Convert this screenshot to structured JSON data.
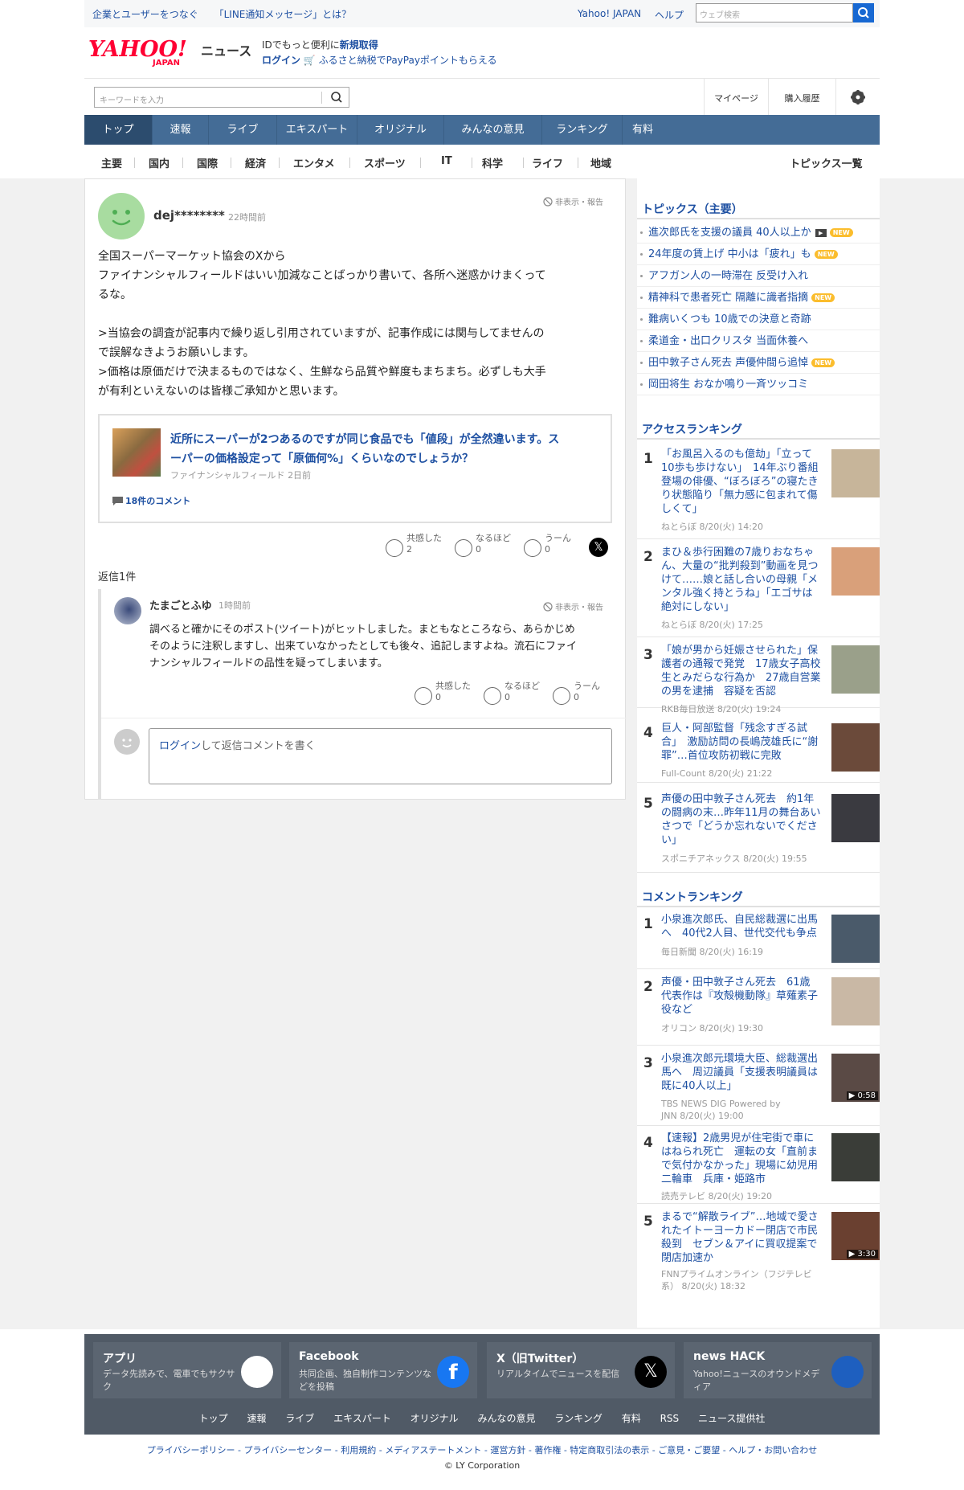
{
  "topbar": {
    "links": [
      "企業とユーザーをつなぐ",
      "「LINE通知メッセージ」とは？"
    ],
    "yahoo_japan": "Yahoo! JAPAN",
    "help": "ヘルプ",
    "search_placeholder": "ウェブ検索"
  },
  "header": {
    "logo_text": "YAHOO!",
    "logo_sub": "JAPAN",
    "news": "ニュース",
    "promo1_prefix": "IDでもっと便利に",
    "promo1_link": "新規取得",
    "promo2_login": "ログイン",
    "promo2_text": "ふるさと納税でPayPayポイントもらえる",
    "keyword_placeholder": "キーワードを入力",
    "mypage": "マイページ",
    "history": "購入履歴"
  },
  "nav": [
    "トップ",
    "速報",
    "ライブ",
    "エキスパート",
    "オリジナル",
    "みんなの意見",
    "ランキング",
    "有料"
  ],
  "subnav": [
    "主要",
    "国内",
    "国際",
    "経済",
    "エンタメ",
    "スポーツ",
    "IT",
    "科学",
    "ライフ",
    "地域"
  ],
  "subnav_topics": "トピックス一覧",
  "comment": {
    "user": "dej********",
    "time": "22時間前",
    "hide_report": "非表示・報告",
    "lines": [
      "全国スーパーマーケット協会のXから",
      "ファイナンシャルフィールドはいい加減なことばっかり書いて、各所へ迷惑かけまくって",
      "るな。",
      "",
      ">当協会の調査が記事内で繰り返し引用されていますが、記事作成には関与してませんの",
      "で誤解なきようお願いします。",
      ">価格は原価だけで決まるものではなく、生鮮なら品質や鮮度もまちまち。必ずしも大手",
      "が有利といえないのは皆様ご承知かと思います。"
    ],
    "article_title_1": "近所にスーパーが2つあるのですが同じ食品でも「値段」が全然違います。ス",
    "article_title_2": "ーパーの価格設定って「原価何%」くらいなのでしょうか？",
    "article_source": "ファイナンシャルフィールド",
    "article_time": "2日前",
    "article_comments": "18件のコメント",
    "reactions": [
      {
        "label": "共感した",
        "count": "2"
      },
      {
        "label": "なるほど",
        "count": "0"
      },
      {
        "label": "うーん",
        "count": "0"
      }
    ],
    "replies_label": "返信1件"
  },
  "reply": {
    "user": "たまごとふゆ",
    "time": "1時間前",
    "hide_report": "非表示・報告",
    "lines": [
      "調べると確かにそのポスト(ツイート)がヒットしました。まともなところなら、あらかじめ",
      "そのように注釈しますし、出来ていなかったとしても後々、追記しますよね。流石にファイ",
      "ナンシャルフィールドの品性を疑ってしまいます。"
    ],
    "reactions": [
      {
        "label": "共感した",
        "count": "0"
      },
      {
        "label": "なるほど",
        "count": "0"
      },
      {
        "label": "うーん",
        "count": "0"
      }
    ],
    "login_link": "ログイン",
    "login_text": "して返信コメントを書く"
  },
  "topics": {
    "heading": "トピックス（主要）",
    "items": [
      {
        "text": "進次郎氏を支援の議員 40人以上か",
        "video": true,
        "new": true
      },
      {
        "text": "24年度の賃上げ 中小は「疲れ」も",
        "video": false,
        "new": true
      },
      {
        "text": "アフガン人の一時滞在 反受け入れ",
        "video": false,
        "new": false
      },
      {
        "text": "精神科で患者死亡 隔離に識者指摘",
        "video": false,
        "new": true
      },
      {
        "text": "難病いくつも 10歳での決意と奇跡",
        "video": false,
        "new": false
      },
      {
        "text": "柔道金・出口クリスタ 当面休養へ",
        "video": false,
        "new": false
      },
      {
        "text": "田中敦子さん死去 声優仲間ら追悼",
        "video": false,
        "new": true
      },
      {
        "text": "岡田将生 おなか鳴り一斉ツッコミ",
        "video": false,
        "new": false
      }
    ],
    "new_label": "NEW"
  },
  "access_ranking": {
    "heading": "アクセスランキング",
    "items": [
      {
        "rank": "1",
        "title": "「お風呂入るのも億劫」「立って10歩も歩けない」　14年ぶり番組登場の俳優、“ぼろぼろ”の寝たきり状態陥り「無力感に包まれて傷しくて」",
        "source": "ねとらぼ 8/20(火) 14:20",
        "thumb": "#c7b59a"
      },
      {
        "rank": "2",
        "title": "まひ＆歩行困難の7歳りおなちゃん、大量の“批判殺到”動画を見つけて……娘と話し合いの母親「メンタル強く持とうね」「エゴサは絶対にしない」",
        "source": "ねとらぼ 8/20(火) 17:25",
        "thumb": "#d9a07a"
      },
      {
        "rank": "3",
        "title": "「娘が男から妊娠させられた」保護者の通報で発覚　17歳女子高校生とみだらな行為か　27歳自営業の男を逮捕　容疑を否認",
        "source": "RKB毎日放送 8/20(火) 19:24",
        "thumb": "#9aa08a"
      },
      {
        "rank": "4",
        "title": "巨人・阿部監督「残念すぎる試合」　激励訪問の長嶋茂雄氏に“謝罪”…首位攻防初戦に完敗",
        "source": "Full-Count 8/20(火) 21:22",
        "thumb": "#6b4a3a"
      },
      {
        "rank": "5",
        "title": "声優の田中敦子さん死去　約1年の闘病の末…昨年11月の舞台あいさつで「どうか忘れないでください」",
        "source": "スポニチアネックス 8/20(火) 19:55",
        "thumb": "#3a3a40"
      }
    ]
  },
  "comment_ranking": {
    "heading": "コメントランキング",
    "items": [
      {
        "rank": "1",
        "title": "小泉進次郎氏、自民総裁選に出馬へ　40代2人目、世代交代も争点",
        "source": "毎日新聞 8/20(火) 16:19",
        "thumb": "#4a5a6a",
        "duration": ""
      },
      {
        "rank": "2",
        "title": "声優・田中敦子さん死去　61歳　代表作は『攻殻機動隊』草薙素子役など",
        "source": "オリコン 8/20(火) 19:30",
        "thumb": "#c9b8a5",
        "duration": ""
      },
      {
        "rank": "3",
        "title": "小泉進次郎元環境大臣、総裁選出馬へ　周辺議員「支援表明議員は既に40人以上」",
        "source": "TBS NEWS DIG Powered by JNN 8/20(火) 19:00",
        "thumb": "#5a4a45",
        "duration": "▶ 0:58"
      },
      {
        "rank": "4",
        "title": "【速報】2歳男児が住宅街で車にはねられ死亡　運転の女「直前まで気付かなかった」現場に幼児用二輪車　兵庫・姫路市",
        "source": "読売テレビ 8/20(火) 19:20",
        "thumb": "#3a3d38",
        "duration": ""
      },
      {
        "rank": "5",
        "title": "まるで“解散ライブ”…地域で愛されたイトーヨーカドー閉店で市民殺到　セブン＆アイに買収提案で閉店加速か",
        "source": "FNNプライムオンライン（フジテレビ系） 8/20(火) 18:32",
        "thumb": "#6a4030",
        "duration": "▶ 3:30"
      }
    ]
  },
  "footer": {
    "cards": [
      {
        "title": "アプリ",
        "desc": "データ先読みで、電車でもサクサク"
      },
      {
        "title": "Facebook",
        "desc": "共同企画、独自制作コンテンツなどを投稿"
      },
      {
        "title": "X（旧Twitter）",
        "desc": "リアルタイムでニュースを配信"
      },
      {
        "title": "news HACK",
        "desc": "Yahoo!ニュースのオウンドメディア"
      }
    ],
    "nav": [
      "トップ",
      "速報",
      "ライブ",
      "エキスパート",
      "オリジナル",
      "みんなの意見",
      "ランキング",
      "有料",
      "RSS",
      "ニュース提供社"
    ],
    "links": "プライバシーポリシー - プライバシーセンター - 利用規約 - メディアステートメント - 運営方針 - 著作権 - 特定商取引法の表示 - ご意見・ご要望 - ヘルプ・お問い合わせ",
    "copyright": "© LY Corporation"
  }
}
